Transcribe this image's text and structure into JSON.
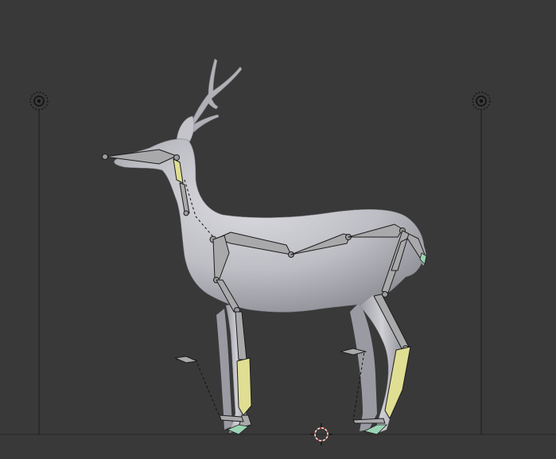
{
  "viewport": {
    "background": "#393939",
    "mesh_color": "#c2c2c8",
    "bone_color": "#a9a9ab",
    "selected_bone_color": "#e0de92",
    "cursor_color": "#c0392b"
  },
  "objects": {
    "mesh": "deer-mesh",
    "armature": "deer-armature",
    "lamps": [
      "lamp-empty-left",
      "lamp-empty-right"
    ],
    "cursor": "3d-cursor"
  }
}
